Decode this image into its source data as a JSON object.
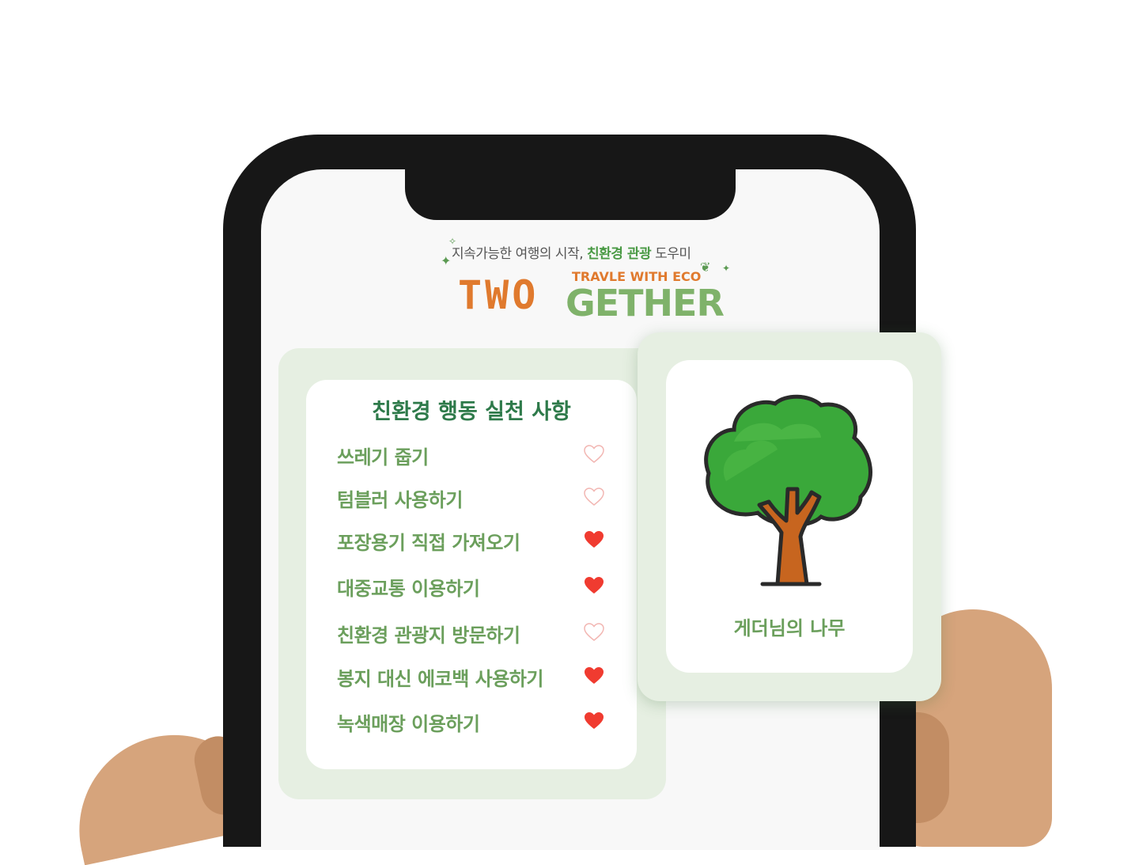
{
  "logo": {
    "tagline_prefix": "지속가능한 여행의 시작,",
    "tagline_highlight": "친환경 관광",
    "tagline_suffix": "도우미",
    "subtitle": "TRAVLE WITH ECO",
    "wordmark_left": "TWO",
    "wordmark_right": "GETHER"
  },
  "checklist": {
    "title": "친환경 행동 실천 사항",
    "items": [
      {
        "label": "쓰레기 줍기",
        "liked": false
      },
      {
        "label": "텀블러 사용하기",
        "liked": false
      },
      {
        "label": "포장용기 직접 가져오기",
        "liked": true
      },
      {
        "label": "대중교통 이용하기",
        "liked": true
      },
      {
        "label": "친환경 관광지 방문하기",
        "liked": false
      },
      {
        "label": "봉지 대신 에코백 사용하기",
        "liked": true
      },
      {
        "label": "녹색매장 이용하기",
        "liked": true
      }
    ],
    "heart_colors": {
      "filled": "#f03b30",
      "outline": "#f2b6b2"
    }
  },
  "tree_card": {
    "caption": "게더님의 나무",
    "icon": "tree-icon"
  },
  "colors": {
    "brand_green": "#2e7a4a",
    "label_green": "#6b9f5c",
    "panel_bg": "#e6efe2",
    "logo_orange": "#e07a2e"
  }
}
